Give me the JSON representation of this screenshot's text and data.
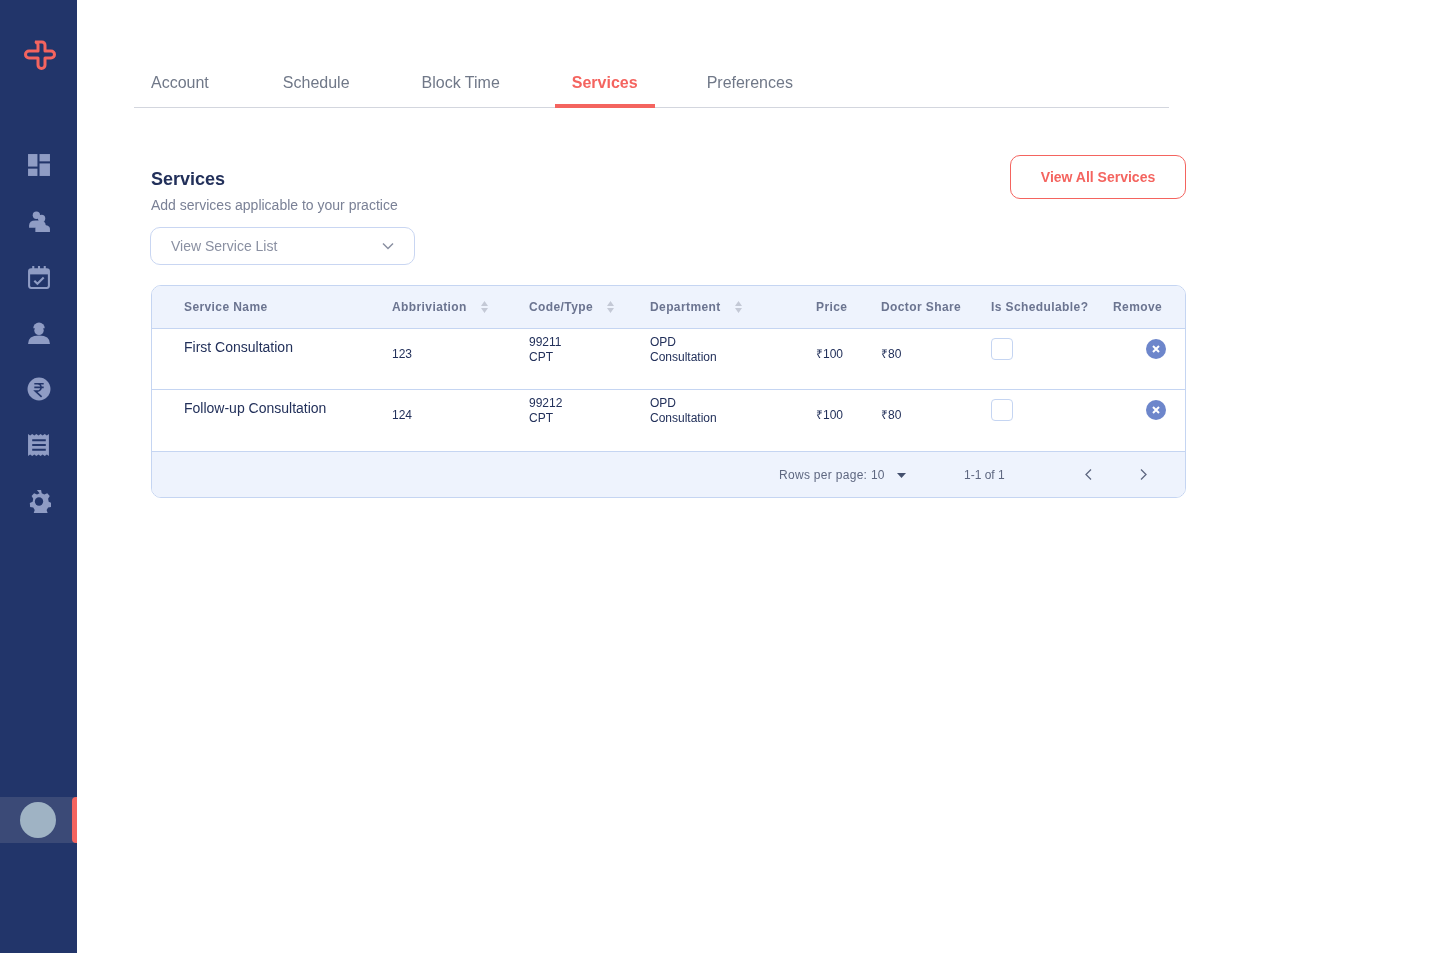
{
  "sidebar": {
    "nav": [
      {
        "selected": false
      },
      {
        "selected": false
      },
      {
        "selected": false
      },
      {
        "selected": false
      },
      {
        "selected": false
      },
      {
        "selected": false
      },
      {
        "selected": false
      }
    ],
    "profile": {
      "selected": true
    }
  },
  "tabs": [
    {
      "label": "Account",
      "selected": false
    },
    {
      "label": "Schedule",
      "selected": false
    },
    {
      "label": "Block Time",
      "selected": false
    },
    {
      "label": "Services",
      "selected": true
    },
    {
      "label": "Preferences",
      "selected": false
    }
  ],
  "section": {
    "title": "Services",
    "subtitle": "Add services applicable to your practice",
    "button": "View All Services"
  },
  "service_select": {
    "placeholder": "View Service List"
  },
  "table": {
    "columns": [
      {
        "label": "Service Name",
        "sortable": false
      },
      {
        "label": "Abbriviation",
        "sortable": true
      },
      {
        "label": "Code/Type",
        "sortable": true
      },
      {
        "label": "Department",
        "sortable": true
      },
      {
        "label": "Price",
        "sortable": false
      },
      {
        "label": "Doctor Share",
        "sortable": false
      },
      {
        "label": "Is Schedulable?",
        "sortable": false
      },
      {
        "label": "Remove",
        "sortable": false
      }
    ],
    "rows": [
      {
        "name": "First Consultation",
        "abbreviation": "123",
        "code": "99211",
        "type": "CPT",
        "department": "OPD",
        "department_sub": "Consultation",
        "price": "₹100",
        "doctor_share": "₹80",
        "schedulable": false
      },
      {
        "name": "Follow-up Consultation",
        "abbreviation": "124",
        "code": "99212",
        "type": "CPT",
        "department": "OPD",
        "department_sub": "Consultation",
        "price": "₹100",
        "doctor_share": "₹80",
        "schedulable": false
      }
    ],
    "footer": {
      "rows_per_page": "Rows per page: 10",
      "range": "1-1 of 1"
    }
  }
}
